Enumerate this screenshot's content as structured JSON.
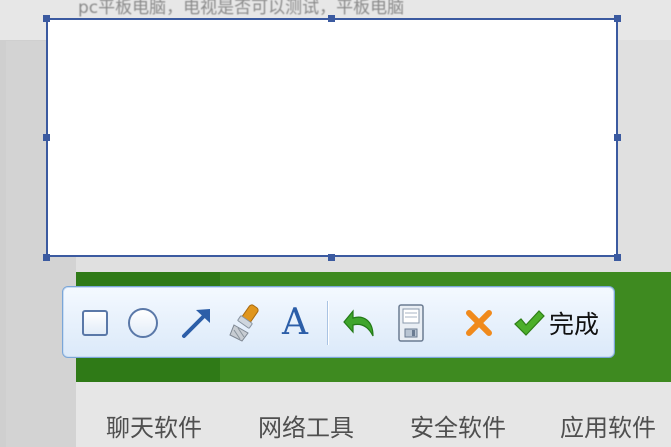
{
  "background": {
    "top_text": "pc平板电脑，电视是否可以测试，平板电脑",
    "tabs": [
      "聊天软件",
      "网络工具",
      "安全软件",
      "应用软件"
    ]
  },
  "toolbar": {
    "tools": [
      {
        "name": "rectangle",
        "icon": "rectangle-icon"
      },
      {
        "name": "ellipse",
        "icon": "ellipse-icon"
      },
      {
        "name": "arrow",
        "icon": "arrow-icon"
      },
      {
        "name": "brush",
        "icon": "brush-icon"
      },
      {
        "name": "text",
        "icon": "text-icon",
        "glyph": "A"
      },
      {
        "name": "undo",
        "icon": "undo-icon"
      },
      {
        "name": "save",
        "icon": "save-icon"
      },
      {
        "name": "cancel",
        "icon": "cancel-icon"
      },
      {
        "name": "done",
        "icon": "check-icon"
      }
    ],
    "done_label": "完成"
  },
  "colors": {
    "selection_border": "#3b5aa0",
    "toolbar_border": "#7aa6d8",
    "green_banner": "#3e8a20",
    "arrow": "#2c5ea8",
    "undo": "#3fa52c",
    "cancel": "#f08a1c",
    "check": "#4caf2a"
  }
}
